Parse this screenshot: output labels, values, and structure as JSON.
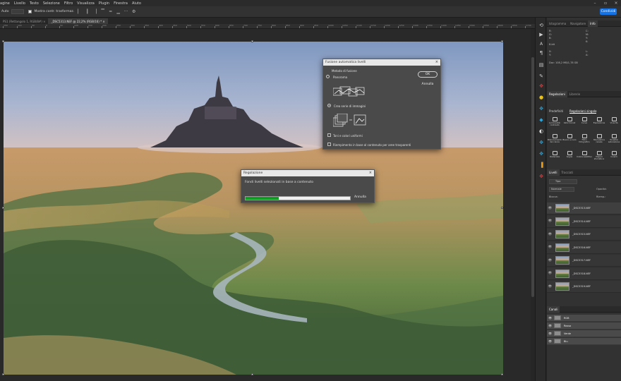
{
  "menubar": {
    "items": [
      "agine",
      "Livello",
      "Testo",
      "Selezione",
      "Filtro",
      "Visualizza",
      "Plugin",
      "Finestra",
      "Aiuto"
    ]
  },
  "optbar": {
    "label_auto": "Auto",
    "label_merge": "Mostra contr. trasformaz.",
    "share": "Condividi",
    "colors": {
      "share": "#1473e6"
    }
  },
  "tabs": [
    {
      "label": "PS1 (Rettangolo 1, RGB/8#)"
    },
    {
      "label": "_DSC5313.NEF @ 22,2% (RGB/16) *"
    }
  ],
  "ruler": {
    "ticks": [
      "150",
      "100",
      "50",
      "0",
      "50",
      "100",
      "150",
      "200",
      "250",
      "300",
      "350",
      "400",
      "450",
      "500",
      "550",
      "600",
      "650",
      "700",
      "750",
      "800",
      "850",
      "900",
      "950",
      "1000",
      "1050",
      "1100",
      "1150",
      "1200",
      "1250",
      "1300",
      "1350",
      "1400",
      "1450",
      "1500",
      "1550",
      "1600",
      "1650",
      "1700"
    ]
  },
  "merge_dialog": {
    "title": "Fusione automatica livelli",
    "method_label": "Metodo di fusione",
    "option_panorama": "Panorama",
    "option_stack": "Crea serie di immagini",
    "checkbox_seamless": "Toni e colori uniformi",
    "checkbox_fill": "Riempimento in base al contenuto per aree trasparenti",
    "ok": "OK",
    "cancel": "Annulla"
  },
  "progress_dialog": {
    "title": "Regolazione",
    "message": "Fondi livelli selezionati in base a contenuto",
    "cancel": "Annulla",
    "progress": 0.32,
    "colors": {
      "fill": "#0f9d24"
    }
  },
  "panels": {
    "top_tabs": [
      "Istogramma",
      "Navigatore",
      "Info"
    ],
    "info_cells": [
      "R:",
      "G:",
      "B:",
      "8-bit",
      "C:",
      "M:",
      "Y:",
      "K:",
      "X:",
      "Y:",
      "L:",
      "A:"
    ],
    "doc_line": "Doc: 108,2 MB/1,78 GB",
    "adj_tabs": [
      "Regolazioni",
      "Librerie"
    ],
    "adj_sub": [
      "Predefiniti",
      "Regolazioni singole"
    ],
    "adjustments": [
      "Luminosità/ contrasto",
      "Valori tonali",
      "Curve",
      "Esposizione",
      "Vivacità",
      "Bilanciamento del colore",
      "Bianco e nero",
      "Filtro fotografico",
      "Miscelatore canale",
      "Tonalità/ saturazione",
      "Posterizza",
      "Soglia",
      "Colore selettivo",
      "Mappa sfumatura",
      "Inverti"
    ],
    "layers_tabs": [
      "Livelli",
      "Tracciati"
    ],
    "layers_filter": "Tipo",
    "opacity_label": "Opacità:",
    "fill_label": "Riemp.:",
    "blend_mode": "Normale",
    "lock_label": "Blocca:",
    "layers": [
      "_DSC5313.NEF",
      "_DSC5314.NEF",
      "_DSC5315.NEF",
      "_DSC5316.NEF",
      "_DSC5317.NEF",
      "_DSC5318.NEF",
      "_DSC5319.NEF"
    ],
    "channels_tab": "Canali",
    "channels": [
      "RGB",
      "Rosso",
      "Verde",
      "Blu"
    ]
  },
  "tools": {
    "icons": [
      "history-icon",
      "play-icon",
      "text-icon",
      "paragraph-icon",
      "layers-comp-icon",
      "brush-icon",
      "timeline-icon",
      "puzzle-icon",
      "color-wheel-icon",
      "gradient-icon",
      "shapes-icon",
      "properties-icon",
      "libraries-icon",
      "paths-icon",
      "swatch-icon"
    ]
  }
}
